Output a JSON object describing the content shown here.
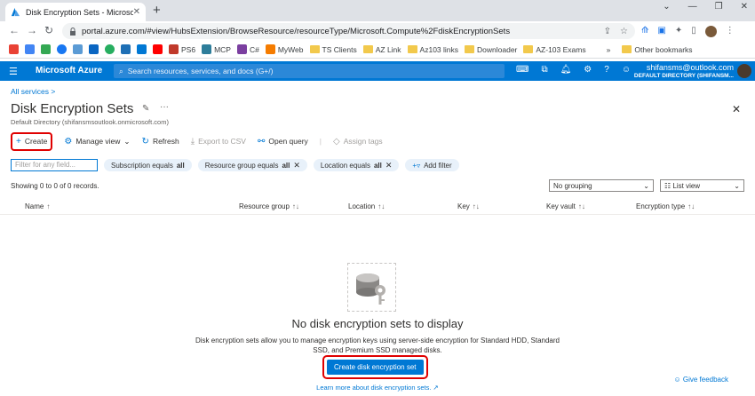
{
  "browser": {
    "tab_title": "Disk Encryption Sets - Microsoft A",
    "url": "portal.azure.com/#view/HubsExtension/BrowseResource/resourceType/Microsoft.Compute%2FdiskEncryptionSets"
  },
  "bookmarks": [
    {
      "label": "PS6",
      "color": "#c0392b"
    },
    {
      "label": "MCP",
      "color": "#2d7d9a"
    },
    {
      "label": "C#",
      "color": "#7b3fa0"
    },
    {
      "label": "MyWeb",
      "color": "#f57c00"
    },
    {
      "label": "TS Clients",
      "folder": true
    },
    {
      "label": "AZ Link",
      "folder": true
    },
    {
      "label": "Az103 links",
      "folder": true
    },
    {
      "label": "Downloader",
      "folder": true
    },
    {
      "label": "AZ-103 Exams",
      "folder": true
    }
  ],
  "bookmarks_overflow": "»",
  "bookmarks_other": "Other bookmarks",
  "azure": {
    "brand": "Microsoft Azure",
    "search_placeholder": "Search resources, services, and docs (G+/)",
    "account_email": "shifansms@outlook.com",
    "account_directory": "DEFAULT DIRECTORY (SHIFANSM..."
  },
  "page": {
    "breadcrumb": "All services",
    "title": "Disk Encryption Sets",
    "subtitle": "Default Directory (shifansmsoutlook.onmicrosoft.com)"
  },
  "commands": {
    "create": "Create",
    "manage_view": "Manage view",
    "refresh": "Refresh",
    "export_csv": "Export to CSV",
    "open_query": "Open query",
    "assign_tags": "Assign tags"
  },
  "filters": {
    "placeholder": "Filter for any field...",
    "pills": [
      {
        "label": "Subscription equals",
        "value": "all"
      },
      {
        "label": "Resource group equals",
        "value": "all"
      },
      {
        "label": "Location equals",
        "value": "all"
      }
    ],
    "add_filter": "Add filter"
  },
  "records": "Showing 0 to 0 of 0 records.",
  "grouping": "No grouping",
  "view": "List view",
  "columns": [
    "Name",
    "Resource group",
    "Location",
    "Key",
    "Key vault",
    "Encryption type"
  ],
  "empty": {
    "title": "No disk encryption sets to display",
    "description": "Disk encryption sets allow you to manage encryption keys using server-side encryption for Standard HDD, Standard SSD, and Premium SSD managed disks.",
    "cta": "Create disk encryption set",
    "learn_more": "Learn more about disk encryption sets."
  },
  "feedback": "Give feedback"
}
